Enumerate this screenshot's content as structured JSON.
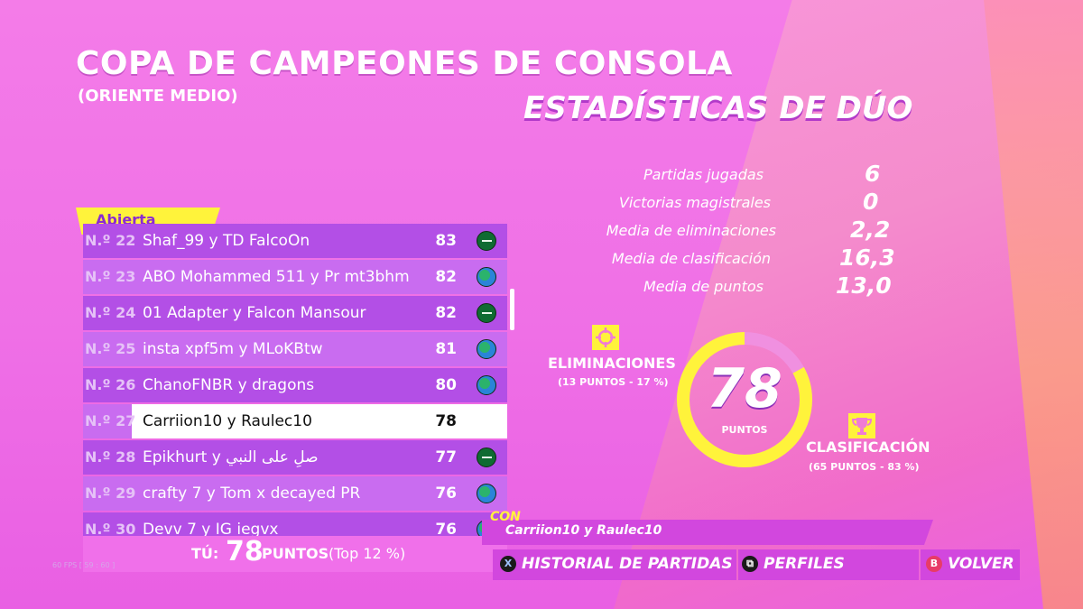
{
  "header": {
    "title": "COPA DE CAMPEONES DE CONSOLA",
    "subtitle": "(ORIENTE MEDIO)",
    "duo_title": "ESTADÍSTICAS DE DÚO"
  },
  "leaderboard": {
    "tab": "Abierta",
    "rows": [
      {
        "rank": "N.º 22",
        "names": "Shaf_99 y TD FalcoOn",
        "points": "83",
        "flag": "saudi-flag-icon"
      },
      {
        "rank": "N.º 23",
        "names": "ABO Mohammed 511 y Pr mt3bhm",
        "points": "82",
        "flag": "globe-icon"
      },
      {
        "rank": "N.º 24",
        "names": "01 Adapter y Falcon Mansour",
        "points": "82",
        "flag": "saudi-flag-icon"
      },
      {
        "rank": "N.º 25",
        "names": "insta xpf5m y MLoKBtw",
        "points": "81",
        "flag": "globe-icon"
      },
      {
        "rank": "N.º 26",
        "names": "ChanoFNBR y dragons",
        "points": "80",
        "flag": "globe-icon"
      },
      {
        "rank": "N.º 27",
        "names": "Carriion10 y Raulec10",
        "points": "78",
        "flag": ""
      },
      {
        "rank": "N.º 28",
        "names": "Epikhurt y صلِ على النبي",
        "points": "77",
        "flag": "saudi-flag-icon"
      },
      {
        "rank": "N.º 29",
        "names": "crafty 7 y Tom x decayed PR",
        "points": "76",
        "flag": "globe-icon"
      },
      {
        "rank": "N.º 30",
        "names": "Devv 7 y IG iegvx",
        "points": "76",
        "flag": "globe-icon"
      }
    ],
    "you": {
      "label": "TÚ:",
      "points": "78",
      "unit": "PUNTOS",
      "top": "(Top 12 %)"
    }
  },
  "stats": [
    {
      "label": "Partidas jugadas",
      "value": "6"
    },
    {
      "label": "Victorias magistrales",
      "value": "0"
    },
    {
      "label": "Media de eliminaciones",
      "value": "2,2"
    },
    {
      "label": "Media de clasificación",
      "value": "16,3"
    },
    {
      "label": "Media de puntos",
      "value": "13,0"
    }
  ],
  "points_ring": {
    "total": "78",
    "label": "PUNTOS",
    "elim_fraction": 0.17,
    "eliminations_label": "ELIMINACIONES",
    "eliminations_sub": "(13 PUNTOS - 17 %)",
    "placement_label": "CLASIFICACIÓN",
    "placement_sub": "(65 PUNTOS - 83 %)",
    "ring_color": "#fff33b"
  },
  "footer": {
    "con_tag": "CON",
    "con_names": "Carriion10 y Raulec10",
    "history_label": "HISTORIAL DE PARTIDAS",
    "profiles_label": "PERFILES",
    "back_label": "VOLVER",
    "fps": "60 FPS [ 59 : 60 ]"
  }
}
